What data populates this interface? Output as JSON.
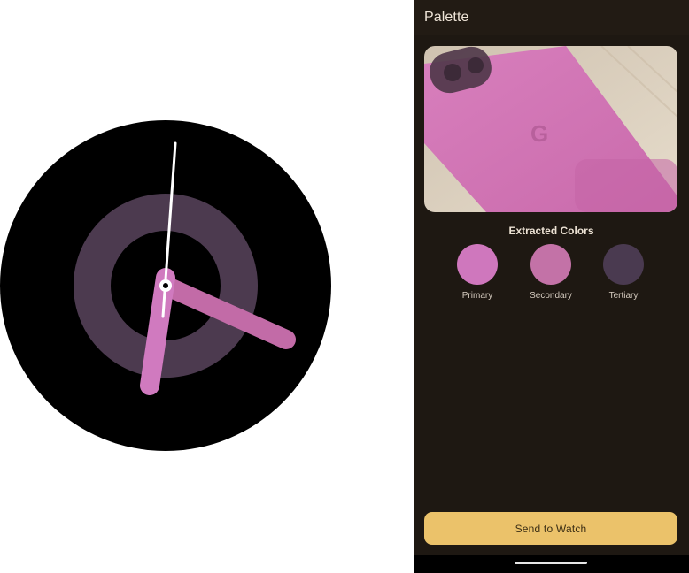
{
  "watch": {
    "face_color": "#000000",
    "ring_color": "#4c3a4f",
    "hour_hand_color": "#c26ba7",
    "minute_hand_color": "#d07abf",
    "second_hand_color": "#ffffff"
  },
  "app": {
    "title": "Palette"
  },
  "photo": {
    "description_icon": "phone-photo-icon",
    "phone_color": "#d27ab9",
    "background_color": "#dcd0bf"
  },
  "extracted": {
    "title": "Extracted Colors",
    "colors": [
      {
        "label": "Primary",
        "hex": "#cf77bd"
      },
      {
        "label": "Secondary",
        "hex": "#c372a7"
      },
      {
        "label": "Tertiary",
        "hex": "#4a3a50"
      }
    ]
  },
  "actions": {
    "send_label": "Send to Watch",
    "send_color": "#ebc26a"
  }
}
